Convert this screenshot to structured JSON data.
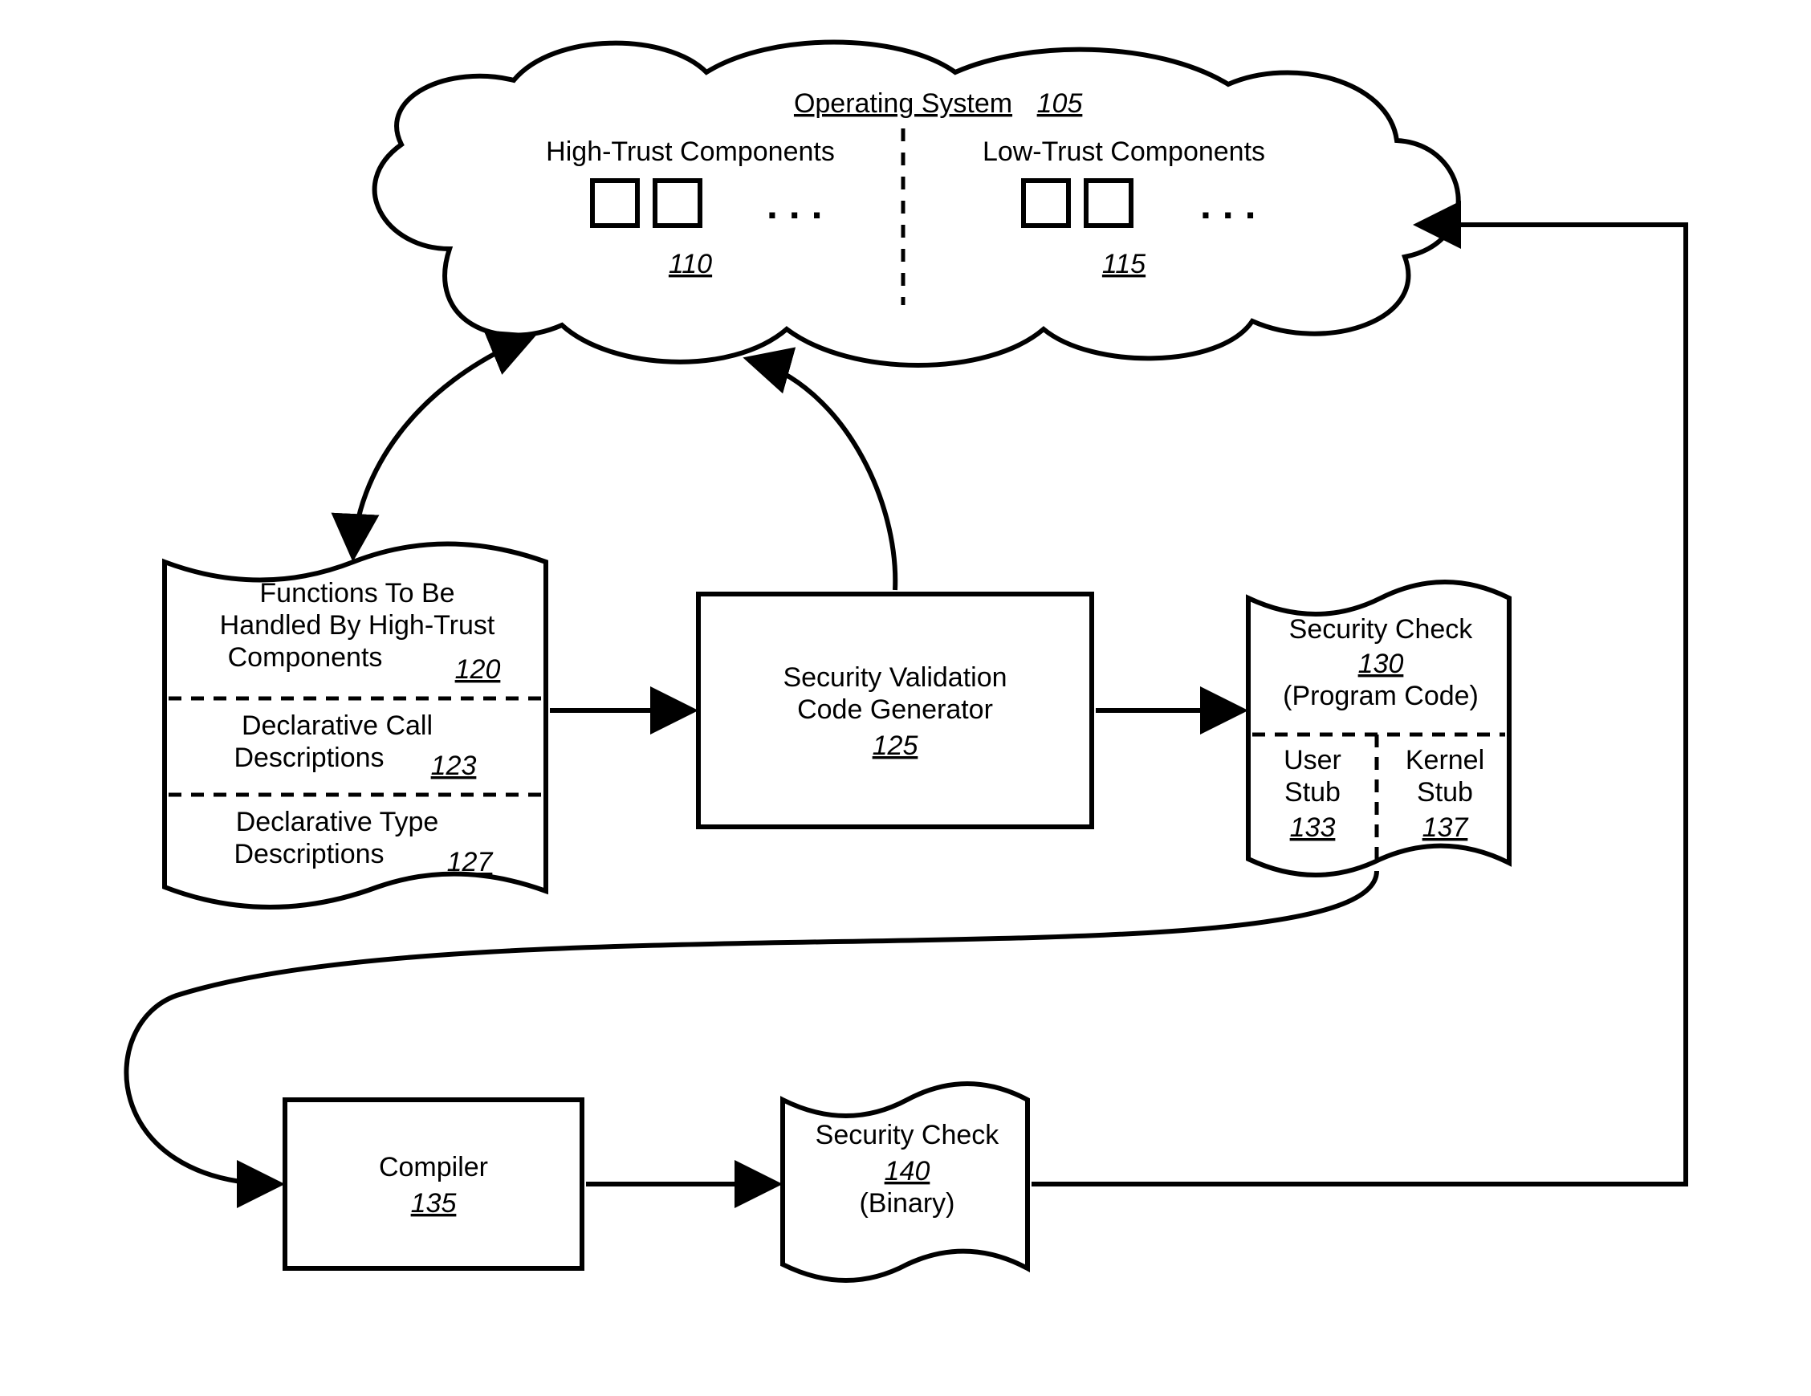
{
  "os": {
    "title": "Operating System",
    "title_num": "105",
    "high_trust_label": "High-Trust Components",
    "high_trust_num": "110",
    "low_trust_label": "Low-Trust Components",
    "low_trust_num": "115",
    "dots": ". . ."
  },
  "functions_doc": {
    "line1": "Functions To Be",
    "line2": "Handled By High-Trust",
    "line3": "Components",
    "num1": "120",
    "line4": "Declarative Call",
    "line5": "Descriptions",
    "num2": "123",
    "line6": "Declarative Type",
    "line7": "Descriptions",
    "num3": "127"
  },
  "generator": {
    "line1": "Security Validation",
    "line2": "Code Generator",
    "num": "125"
  },
  "security_check_src": {
    "line1": "Security Check",
    "num": "130",
    "line2": "(Program Code)",
    "user_stub_l1": "User",
    "user_stub_l2": "Stub",
    "user_stub_num": "133",
    "kernel_stub_l1": "Kernel",
    "kernel_stub_l2": "Stub",
    "kernel_stub_num": "137"
  },
  "compiler": {
    "label": "Compiler",
    "num": "135"
  },
  "security_check_bin": {
    "line1": "Security Check",
    "num": "140",
    "line2": "(Binary)"
  }
}
